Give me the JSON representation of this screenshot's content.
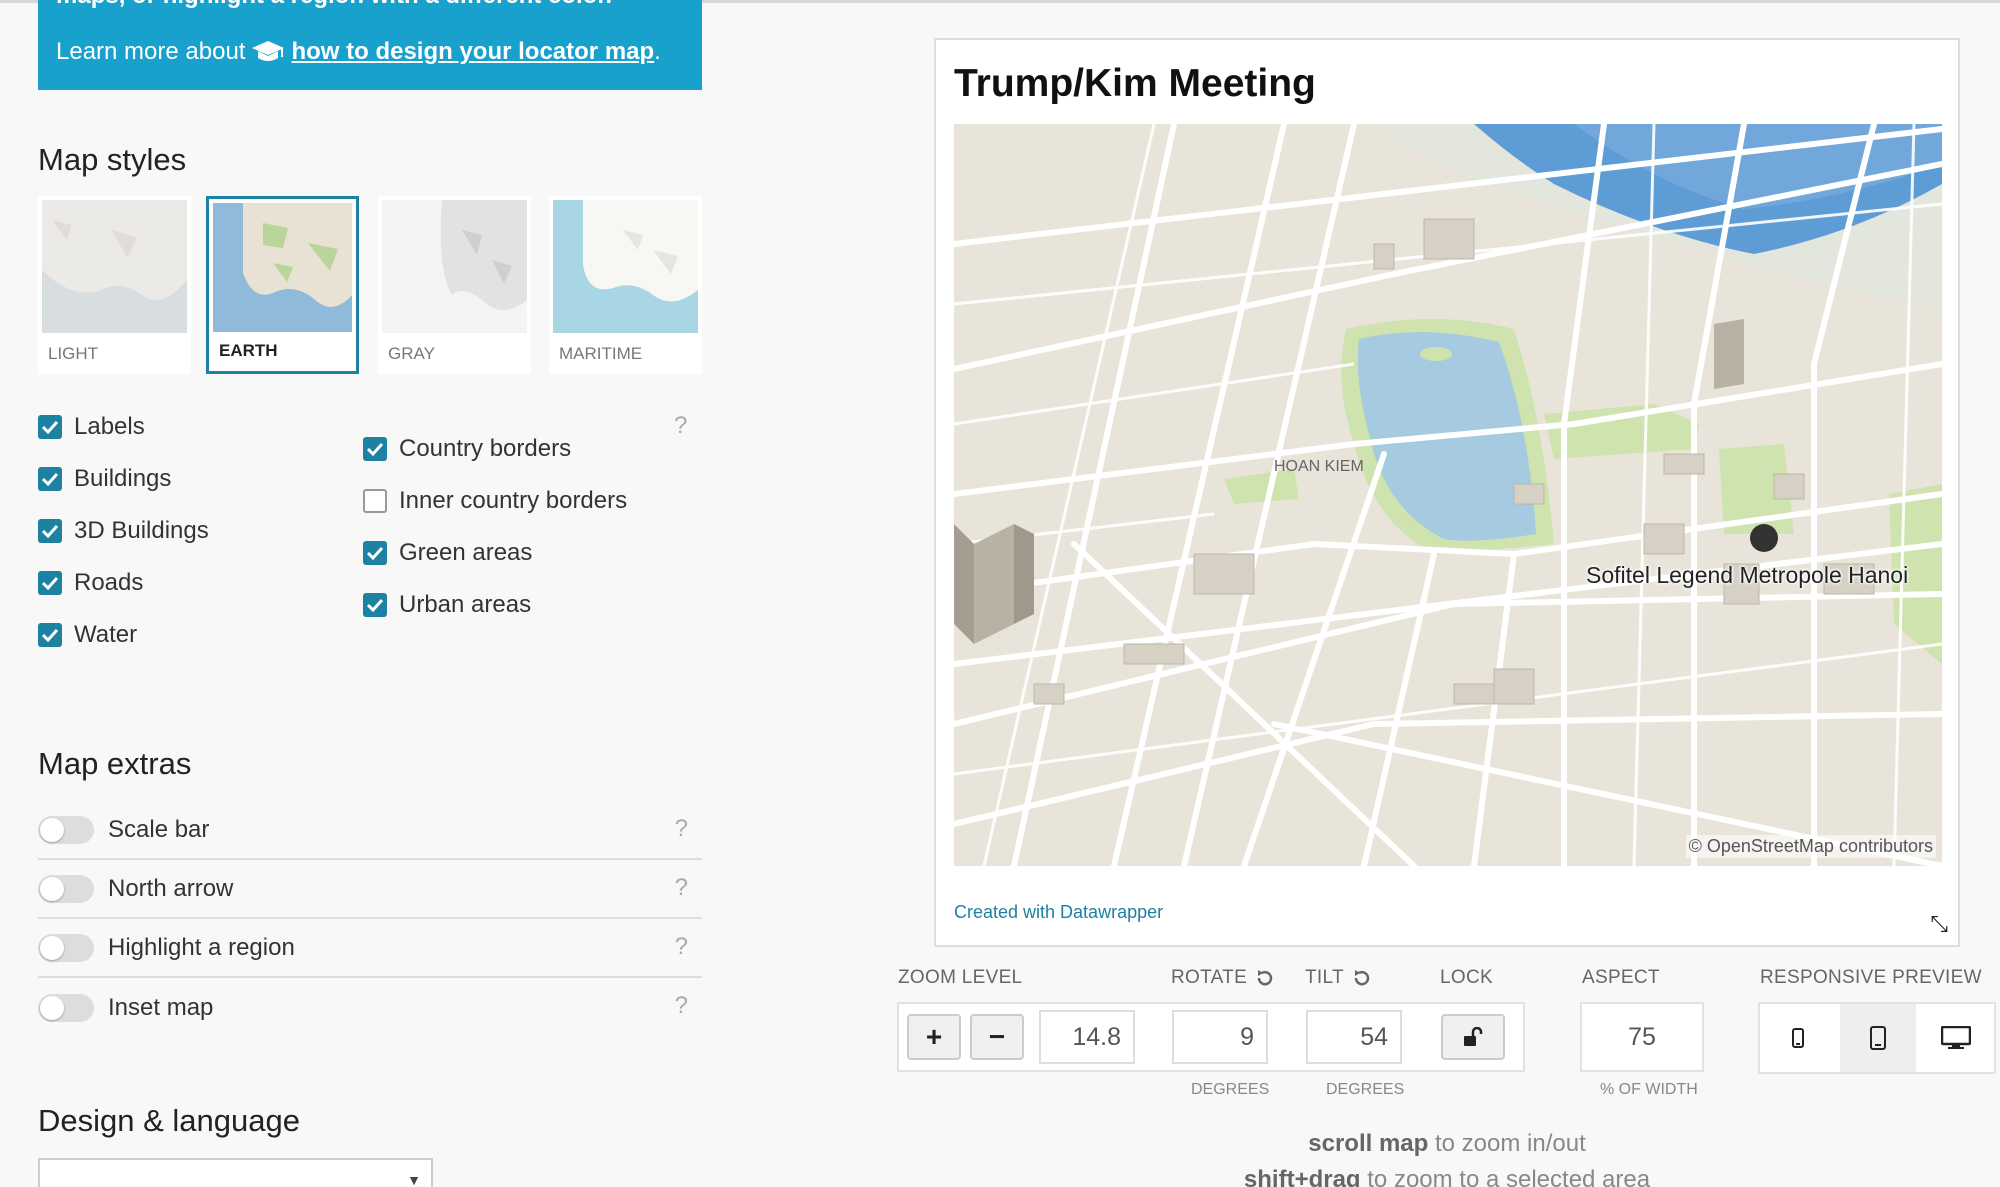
{
  "info_box": {
    "cutoff_text": "maps, or highlight a region with a different color.",
    "learn_prefix": "Learn more about",
    "learn_link": "how to design your locator map",
    "learn_suffix": "."
  },
  "map_styles": {
    "title": "Map styles",
    "tiles": [
      {
        "label": "LIGHT",
        "selected": false
      },
      {
        "label": "EARTH",
        "selected": true
      },
      {
        "label": "GRAY",
        "selected": false
      },
      {
        "label": "MARITIME",
        "selected": false
      }
    ]
  },
  "layers": {
    "left": [
      {
        "label": "Labels",
        "checked": true
      },
      {
        "label": "Buildings",
        "checked": true
      },
      {
        "label": "3D Buildings",
        "checked": true
      },
      {
        "label": "Roads",
        "checked": true
      },
      {
        "label": "Water",
        "checked": true
      }
    ],
    "right": [
      {
        "label": "Country borders",
        "checked": true
      },
      {
        "label": "Inner country borders",
        "checked": false
      },
      {
        "label": "Green areas",
        "checked": true
      },
      {
        "label": "Urban areas",
        "checked": true
      }
    ],
    "help": "?"
  },
  "map_extras": {
    "title": "Map extras",
    "items": [
      {
        "label": "Scale bar",
        "on": false,
        "help": "?"
      },
      {
        "label": "North arrow",
        "on": false,
        "help": "?"
      },
      {
        "label": "Highlight a region",
        "on": false,
        "help": "?"
      },
      {
        "label": "Inset map",
        "on": false,
        "help": "?"
      }
    ]
  },
  "design": {
    "title": "Design & language",
    "select_arrow": "▼"
  },
  "preview": {
    "title": "Trump/Kim Meeting",
    "district_label": "HOAN KIEM",
    "marker_label": "Sofitel Legend Metropole Hanoi",
    "attribution": "© OpenStreetMap contributors",
    "credit": "Created with Datawrapper",
    "resize_icon": "⤡"
  },
  "controls": {
    "zoom": {
      "label": "ZOOM LEVEL",
      "plus": "+",
      "minus": "−",
      "value": "14.8"
    },
    "rotate": {
      "label": "ROTATE",
      "value": "9",
      "unit": "DEGREES"
    },
    "tilt": {
      "label": "TILT",
      "value": "54",
      "unit": "DEGREES"
    },
    "lock": {
      "label": "LOCK"
    },
    "aspect": {
      "label": "ASPECT",
      "value": "75",
      "unit": "% OF WIDTH"
    },
    "responsive": {
      "label": "RESPONSIVE PREVIEW"
    }
  },
  "hints": {
    "line1_bold": "scroll map",
    "line1_rest": " to zoom in/out",
    "line2_bold": "shift+drag",
    "line2_rest": " to zoom to a selected area"
  },
  "colors": {
    "accent": "#18a1cd",
    "checkbox": "#1d81a2",
    "water": "#a6cae0",
    "river": "#5e9cd6",
    "land": "#e8e4da",
    "green": "#cfe3ae"
  }
}
